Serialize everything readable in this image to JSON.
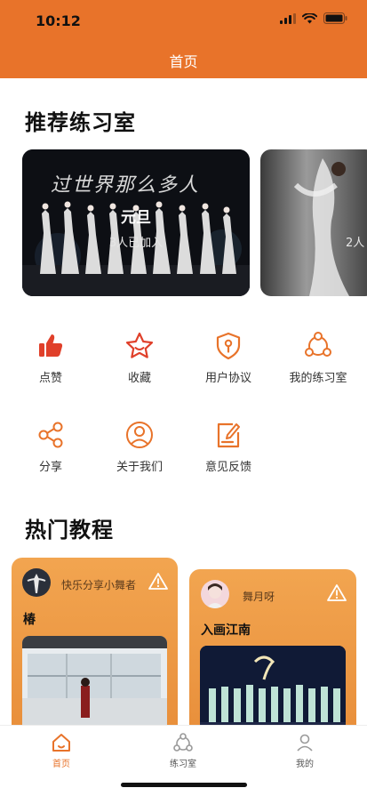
{
  "status_bar": {
    "time": "10:12",
    "icons": [
      "signal-icon",
      "wifi-icon",
      "battery-icon"
    ]
  },
  "header": {
    "title": "首页"
  },
  "rooms": {
    "title": "推荐练习室",
    "items": [
      {
        "calligraphy": "过世界那么多人",
        "name": "元旦",
        "count": "3人已加入"
      },
      {
        "count": "2人"
      }
    ]
  },
  "menu": [
    {
      "label": "点赞",
      "icon": "thumbs-up-icon"
    },
    {
      "label": "收藏",
      "icon": "star-icon"
    },
    {
      "label": "用户协议",
      "icon": "shield-icon"
    },
    {
      "label": "我的练习室",
      "icon": "group-icon"
    },
    {
      "label": "分享",
      "icon": "share-icon"
    },
    {
      "label": "关于我们",
      "icon": "user-circle-icon"
    },
    {
      "label": "意见反馈",
      "icon": "feedback-icon"
    }
  ],
  "tutorials": {
    "title": "热门教程",
    "items": [
      {
        "author": "快乐分享小舞者",
        "title": "椿"
      },
      {
        "author": "舞月呀",
        "title": "入画江南"
      }
    ]
  },
  "bottom_nav": [
    {
      "label": "首页",
      "icon": "home-icon",
      "active": true
    },
    {
      "label": "练习室",
      "icon": "practice-room-icon",
      "active": false
    },
    {
      "label": "我的",
      "icon": "profile-icon",
      "active": false
    }
  ],
  "colors": {
    "accent": "#e8732a",
    "card_orange": "#f2a550",
    "icon_red": "#e0402a"
  }
}
